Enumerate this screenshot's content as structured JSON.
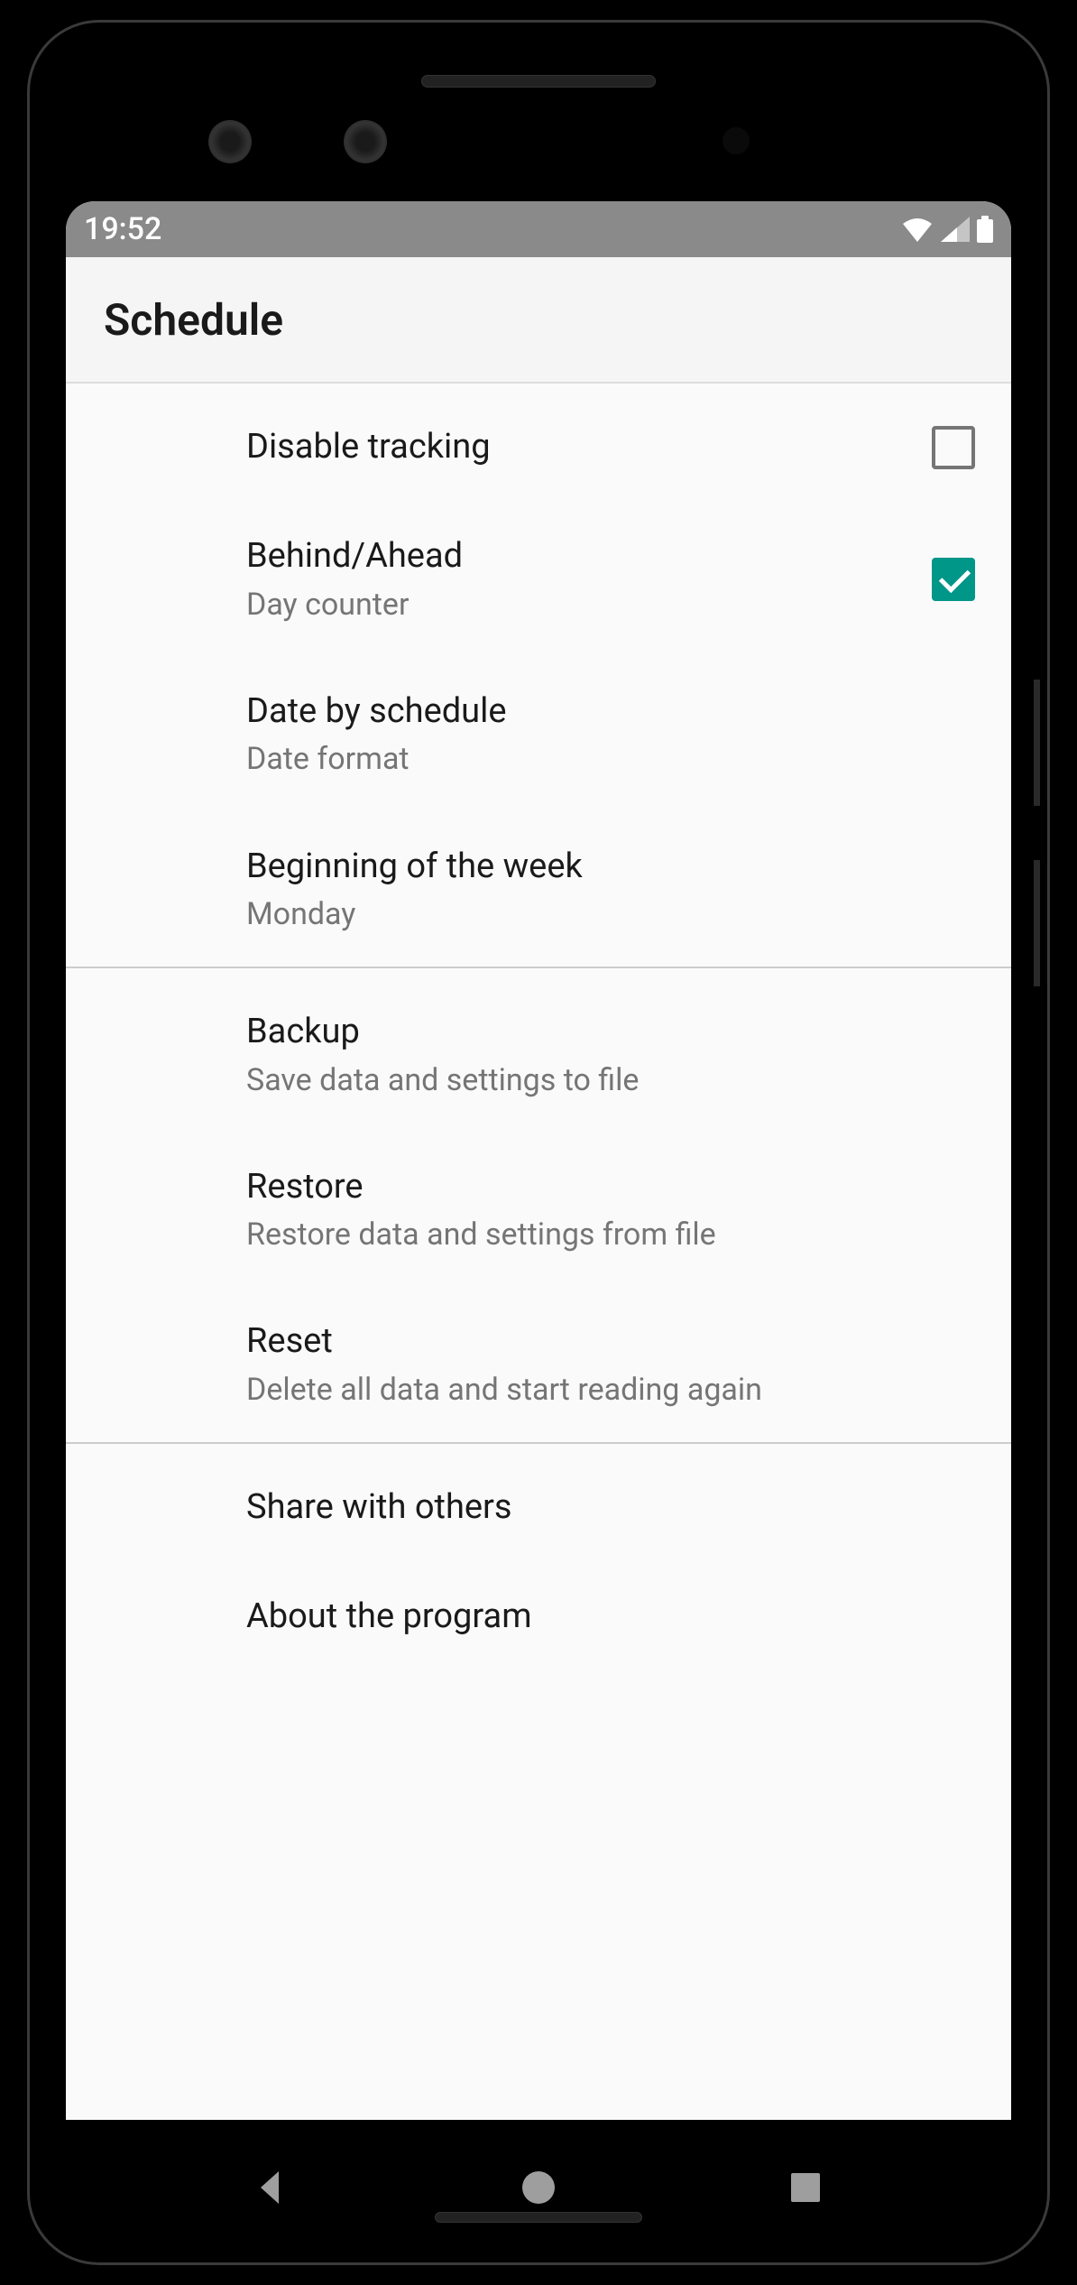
{
  "status_bar": {
    "time": "19:52"
  },
  "title": "Schedule",
  "sections": [
    {
      "rows": [
        {
          "title": "Disable tracking",
          "subtitle": null,
          "checkbox": "unchecked"
        },
        {
          "title": "Behind/Ahead",
          "subtitle": "Day counter",
          "checkbox": "checked"
        },
        {
          "title": "Date by schedule",
          "subtitle": "Date format",
          "checkbox": null
        },
        {
          "title": "Beginning of the week",
          "subtitle": "Monday",
          "checkbox": null
        }
      ]
    },
    {
      "rows": [
        {
          "title": "Backup",
          "subtitle": "Save data and settings to file",
          "checkbox": null
        },
        {
          "title": "Restore",
          "subtitle": "Restore data and settings from file",
          "checkbox": null
        },
        {
          "title": "Reset",
          "subtitle": "Delete all data and start reading again",
          "checkbox": null
        }
      ]
    },
    {
      "rows": [
        {
          "title": "Share with others",
          "subtitle": null,
          "checkbox": null
        },
        {
          "title": "About the program",
          "subtitle": null,
          "checkbox": null
        }
      ]
    }
  ]
}
